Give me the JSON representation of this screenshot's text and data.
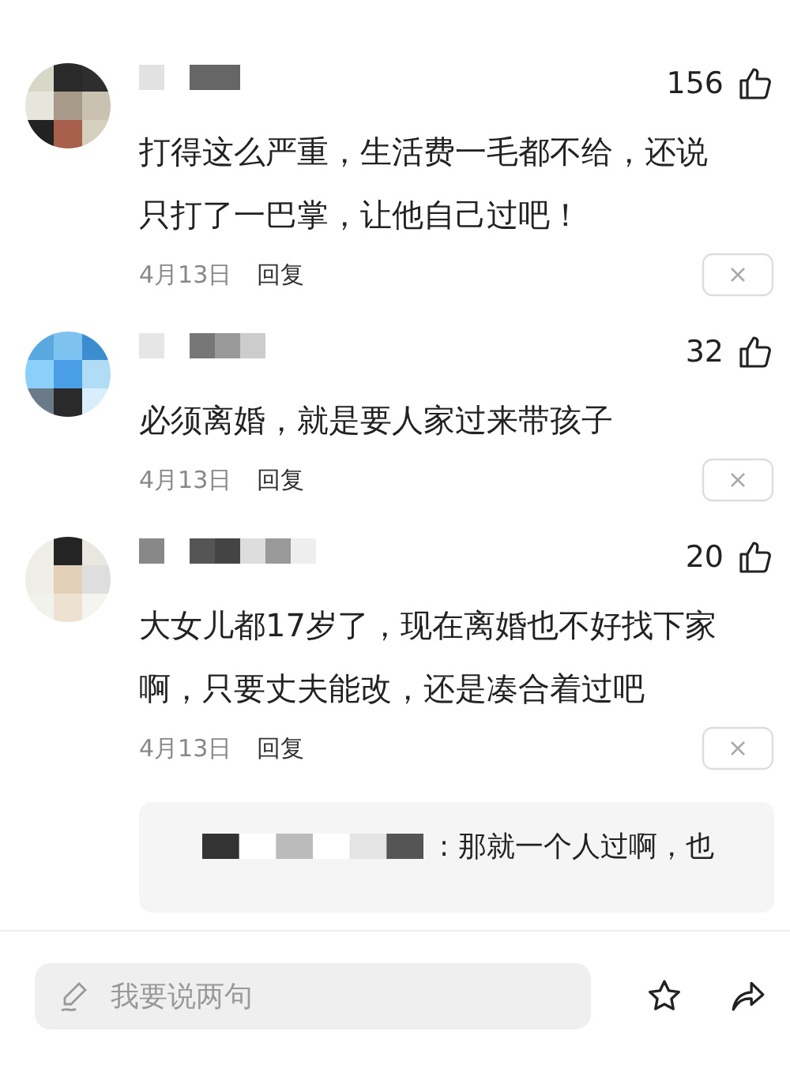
{
  "comments": [
    {
      "likes": "156",
      "text": "打得这么严重，生活费一毛都不给，还说只打了一巴掌，让他自己过吧！",
      "date": "4月13日",
      "reply_action": "回复"
    },
    {
      "likes": "32",
      "text": "必须离婚，就是要人家过来带孩子",
      "date": "4月13日",
      "reply_action": "回复"
    },
    {
      "likes": "20",
      "text": "大女儿都17岁了，现在离婚也不好找下家啊，只要丈夫能改，还是凑合着过吧",
      "date": "4月13日",
      "reply_action": "回复",
      "replies": [
        {
          "text": ": 那就一个人过啊，也"
        }
      ]
    }
  ],
  "composer": {
    "placeholder": "我要说两句"
  }
}
